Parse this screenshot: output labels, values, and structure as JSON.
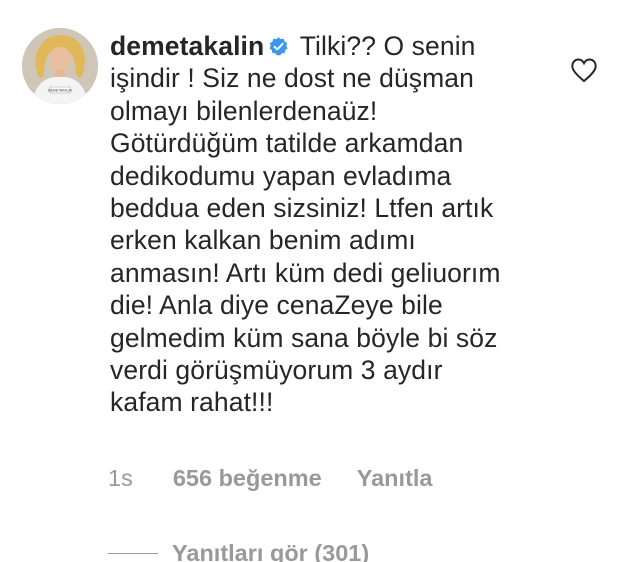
{
  "comment": {
    "username": "demetakalin",
    "text": "Tilki?? O senin işindir ! Siz ne dost ne düşman olmayı bilenlerdenaüz! Götürdüğüm tatilde arkamdan dedikodumu yapan evladıma beddua eden sizsiniz! Ltfen artık erken kalkan benim adımı anmasın! Artı küm dedi geliuorım die! Anla diye cenaZeye bile gelmedim küm sana böyle bi söz verdi görüşmüyorum 3 aydır kafam rahat!!!"
  },
  "meta": {
    "time": "1s",
    "likes": "656 beğenme",
    "reply": "Yanıtla"
  },
  "replies": {
    "label": "Yanıtları gör (301)"
  },
  "avatar": {
    "shirt_text": "DEMETAKALIN"
  },
  "colors": {
    "text": "#262626",
    "secondary": "#999999",
    "verified": "#3897f0",
    "background": "#ffffff"
  },
  "icons": {
    "verified": "verified-badge-icon",
    "like": "heart-outline-icon"
  }
}
